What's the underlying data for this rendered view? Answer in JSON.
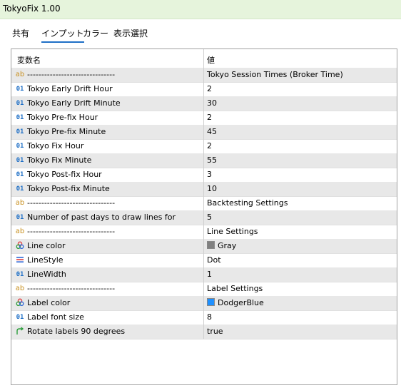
{
  "window": {
    "title": "TokyoFix 1.00"
  },
  "tabs": [
    {
      "label": "共有",
      "active": false
    },
    {
      "label": "インプット",
      "active": true
    },
    {
      "label": "カラー",
      "active": false
    },
    {
      "label": "表示選択",
      "active": false
    }
  ],
  "table": {
    "headers": {
      "name": "変数名",
      "value": "値"
    },
    "rows": [
      {
        "type": "string",
        "icon": "ab",
        "name": "-------------------------------",
        "value": "Tokyo Session Times (Broker Time)"
      },
      {
        "type": "int",
        "icon": "01",
        "name": "Tokyo Early Drift Hour",
        "value": "2"
      },
      {
        "type": "int",
        "icon": "01",
        "name": "Tokyo Early Drift Minute",
        "value": "30"
      },
      {
        "type": "int",
        "icon": "01",
        "name": "Tokyo Pre-fix Hour",
        "value": "2"
      },
      {
        "type": "int",
        "icon": "01",
        "name": "Tokyo Pre-fix Minute",
        "value": "45"
      },
      {
        "type": "int",
        "icon": "01",
        "name": "Tokyo Fix Hour",
        "value": "2"
      },
      {
        "type": "int",
        "icon": "01",
        "name": "Tokyo Fix Minute",
        "value": "55"
      },
      {
        "type": "int",
        "icon": "01",
        "name": "Tokyo Post-fix Hour",
        "value": "3"
      },
      {
        "type": "int",
        "icon": "01",
        "name": "Tokyo Post-fix Minute",
        "value": "10"
      },
      {
        "type": "string",
        "icon": "ab",
        "name": "-------------------------------",
        "value": "Backtesting Settings"
      },
      {
        "type": "int",
        "icon": "01",
        "name": "Number of past days to draw lines for",
        "value": "5"
      },
      {
        "type": "string",
        "icon": "ab",
        "name": "-------------------------------",
        "value": "Line Settings"
      },
      {
        "type": "color",
        "icon": "color-palette-icon",
        "name": "Line color",
        "value": "Gray",
        "swatch": "#808080"
      },
      {
        "type": "style",
        "icon": "line-style-icon",
        "name": "LineStyle",
        "value": "Dot"
      },
      {
        "type": "int",
        "icon": "01",
        "name": "LineWidth",
        "value": "1"
      },
      {
        "type": "string",
        "icon": "ab",
        "name": "-------------------------------",
        "value": "Label Settings"
      },
      {
        "type": "color",
        "icon": "color-palette-icon",
        "name": "Label color",
        "value": "DodgerBlue",
        "swatch": "#1e90ff"
      },
      {
        "type": "int",
        "icon": "01",
        "name": "Label font size",
        "value": "8"
      },
      {
        "type": "bool",
        "icon": "bool-arrow-icon",
        "name": "Rotate labels 90 degrees",
        "value": "true"
      }
    ]
  },
  "colors": {
    "title_bar": "#e6f4dc",
    "accent": "#1e6fc6",
    "row_alt": "#e8e8e8"
  }
}
